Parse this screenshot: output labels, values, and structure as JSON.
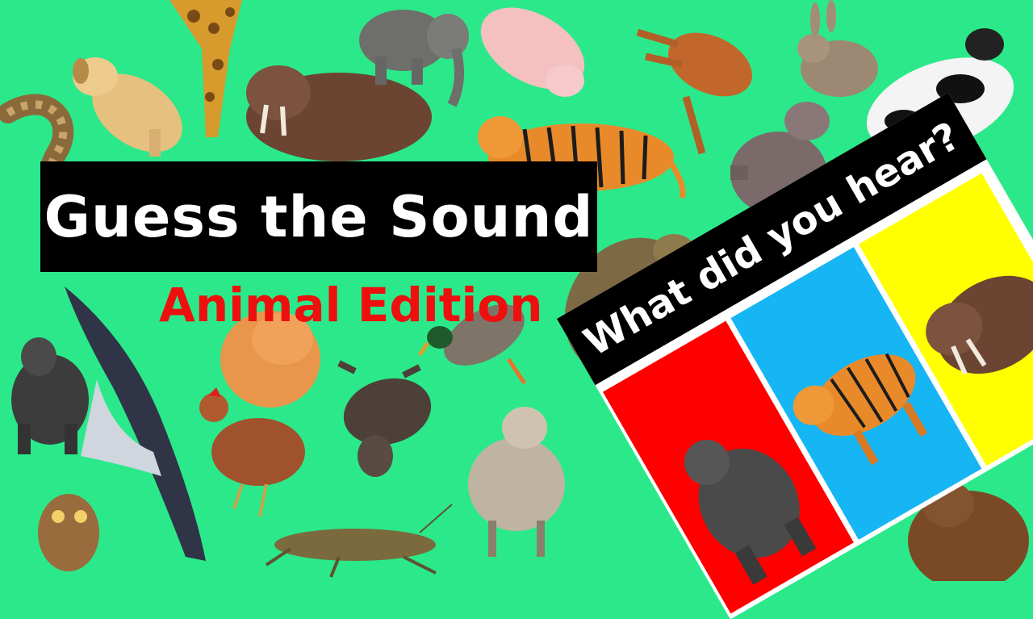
{
  "title": "Guess the Sound",
  "subtitle": "Animal Edition",
  "card": {
    "question": "What did you hear?",
    "options": [
      {
        "animal": "gorilla",
        "color": "#ff0000"
      },
      {
        "animal": "tiger",
        "color": "#16b5f4"
      },
      {
        "animal": "walrus",
        "color": "#ffff00"
      }
    ]
  },
  "background_animals": [
    "snake",
    "dog",
    "giraffe",
    "walrus",
    "elephant",
    "pig",
    "deer",
    "rabbit",
    "cow",
    "tiger",
    "hippo",
    "frog",
    "cat",
    "duck",
    "gorilla",
    "whale",
    "chicken",
    "donkey",
    "sheep",
    "owl",
    "grasshopper",
    "bear"
  ],
  "colors": {
    "background": "#2be98a",
    "title_box": "#000000",
    "title_text": "#ffffff",
    "subtitle": "#ee0f0f"
  }
}
